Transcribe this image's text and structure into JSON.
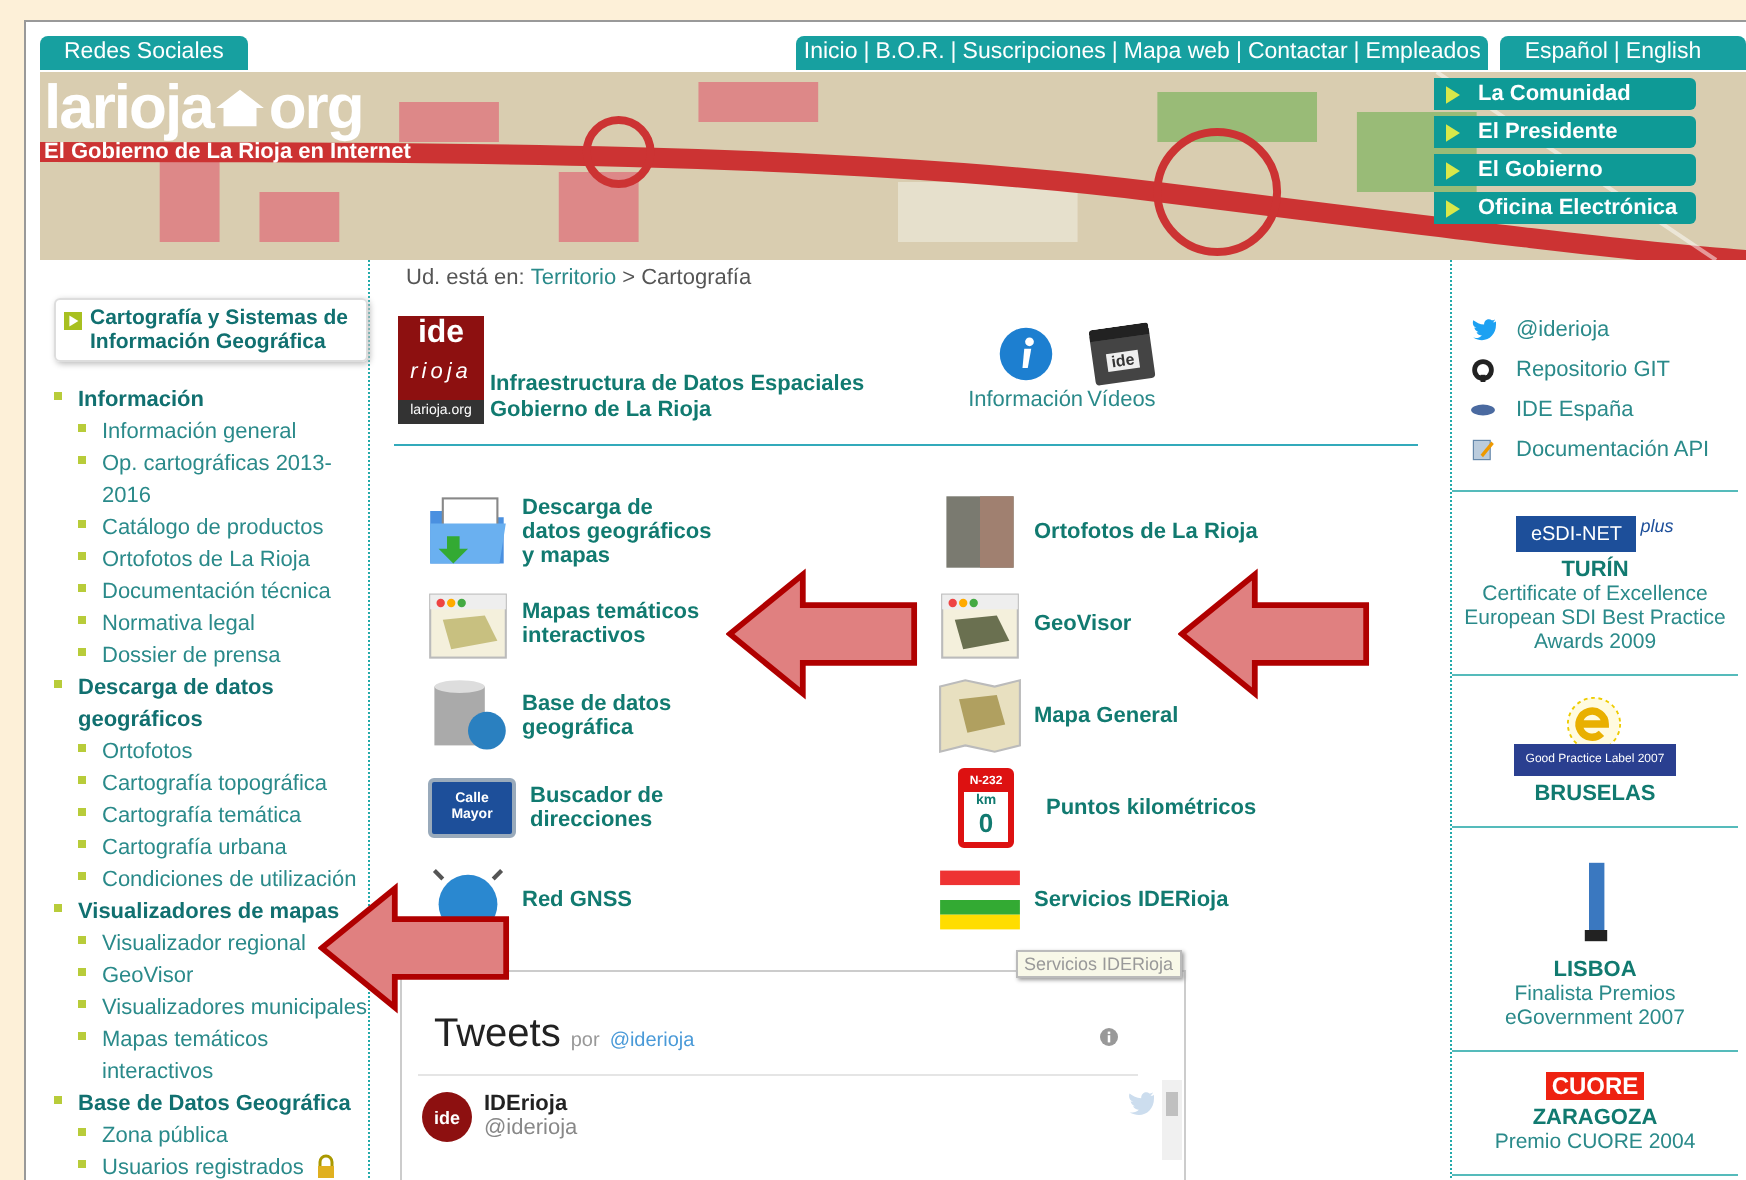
{
  "top_bar": {
    "social_tab": "Redes Sociales",
    "separator": "|",
    "nav_links": [
      "Inicio",
      "B.O.R.",
      "Suscripciones",
      "Mapa web",
      "Contactar",
      "Empleados"
    ],
    "languages": [
      "Español",
      "English"
    ]
  },
  "banner": {
    "logo_left": "larioja",
    "logo_right": "org",
    "tagline": "El Gobierno de La Rioja en Internet",
    "menu": [
      "La Comunidad",
      "El Presidente",
      "El Gobierno",
      "Oficina Electrónica"
    ]
  },
  "sidebar": {
    "heading": "Cartografía y Sistemas de Información Geográfica",
    "sections": [
      {
        "label": "Información",
        "children": [
          {
            "label": "Información general",
            "locked": false
          },
          {
            "label": "Op. cartográficas 2013-2016",
            "locked": false
          },
          {
            "label": "Catálogo de productos",
            "locked": false
          },
          {
            "label": "Ortofotos de La Rioja",
            "locked": false
          },
          {
            "label": "Documentación técnica",
            "locked": false
          },
          {
            "label": "Normativa legal",
            "locked": false
          },
          {
            "label": "Dossier de prensa",
            "locked": false
          }
        ]
      },
      {
        "label": "Descarga de datos geográficos",
        "children": [
          {
            "label": "Ortofotos",
            "locked": false
          },
          {
            "label": "Cartografía topográfica",
            "locked": false
          },
          {
            "label": "Cartografía temática",
            "locked": false
          },
          {
            "label": "Cartografía urbana",
            "locked": false
          },
          {
            "label": "Condiciones de utilización",
            "locked": false
          }
        ]
      },
      {
        "label": "Visualizadores de mapas",
        "children": [
          {
            "label": "Visualizador regional",
            "locked": false
          },
          {
            "label": "GeoVisor",
            "locked": false
          },
          {
            "label": "Visualizadores municipales",
            "locked": false
          },
          {
            "label": "Mapas temáticos interactivos",
            "locked": false
          }
        ]
      },
      {
        "label": "Base de Datos Geográfica",
        "children": [
          {
            "label": "Zona pública",
            "locked": false
          },
          {
            "label": "Usuarios registrados",
            "locked": true
          }
        ]
      }
    ]
  },
  "breadcrumb": {
    "prefix": "Ud. está en:",
    "link": "Territorio",
    "separator": ">",
    "current": "Cartografía"
  },
  "ide_header": {
    "logo_top": "ide",
    "logo_middle": "rioja",
    "logo_bottom": "larioja.org",
    "title_lines": [
      "Infraestructura de Datos Espaciales",
      "Gobierno de La Rioja"
    ]
  },
  "info_links": [
    {
      "kind": "info",
      "label": "Información"
    },
    {
      "kind": "video",
      "label": "Vídeos",
      "icon_text": "ide"
    }
  ],
  "services": [
    {
      "kind": "folder",
      "label": "Descarga de datos geográficos y mapas"
    },
    {
      "kind": "map-window",
      "label": "Mapas temáticos interactivos"
    },
    {
      "kind": "database",
      "label": "Base de datos geográfica"
    },
    {
      "kind": "street-sign",
      "label": "Buscador de direcciones",
      "icon_text": [
        "Calle",
        "Mayor"
      ]
    },
    {
      "kind": "globe",
      "label": "Red GNSS"
    },
    {
      "kind": "aerial-photo",
      "label": "Ortofotos de La Rioja"
    },
    {
      "kind": "map-window",
      "label": "GeoVisor"
    },
    {
      "kind": "folded-map",
      "label": "Mapa General"
    },
    {
      "kind": "km-sign",
      "label": "Puntos kilométricos",
      "icon_text": [
        "N-232",
        "km",
        "0"
      ]
    },
    {
      "kind": "flag",
      "label": "Servicios IDERioja"
    }
  ],
  "tooltip": "Servicios IDERioja",
  "tweets": {
    "title": "Tweets",
    "by": "por",
    "handle": "@iderioja",
    "tweet": {
      "avatar_text": "ide",
      "name": "IDErioja",
      "handle": "@iderioja"
    }
  },
  "right_links": [
    {
      "kind": "twitter",
      "label": "@iderioja"
    },
    {
      "kind": "github",
      "label": "Repositorio GIT"
    },
    {
      "kind": "ide",
      "label": "IDE España"
    },
    {
      "kind": "doc",
      "label": "Documentación API"
    }
  ],
  "awards": [
    {
      "kind": "esdi",
      "logo_text": "eSDI-NET",
      "logo_extra": "plus",
      "city": "TURÍN",
      "text": "Certificate of Excellence European SDI Best Practice Awards 2009"
    },
    {
      "kind": "good-practice",
      "logo_text": "Good Practice Label 2007",
      "city": "BRUSELAS"
    },
    {
      "kind": "trophy",
      "city": "LISBOA",
      "text": "Finalista Premios eGovernment 2007"
    },
    {
      "kind": "cuore",
      "logo_text": "CUORE",
      "city": "ZARAGOZA",
      "text": "Premio CUORE 2004"
    }
  ]
}
